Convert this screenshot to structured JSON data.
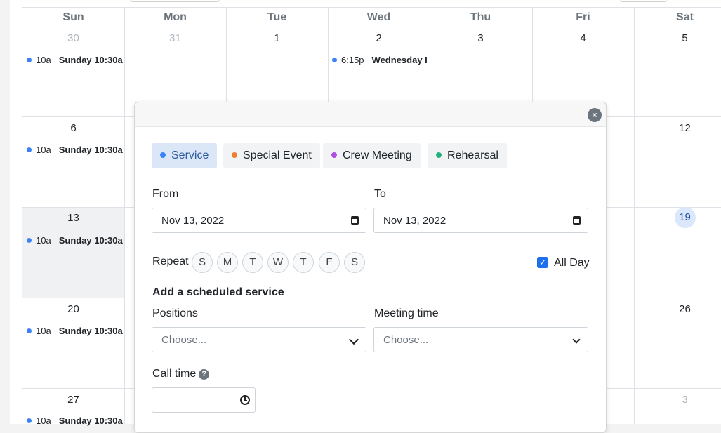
{
  "calendar": {
    "weekdays": [
      "Sun",
      "Mon",
      "Tue",
      "Wed",
      "Thu",
      "Fri",
      "Sat"
    ],
    "weeks": [
      [
        "30",
        "31",
        "1",
        "2",
        "3",
        "4",
        "5"
      ],
      [
        "6",
        "",
        "",
        "",
        "",
        "",
        "12"
      ],
      [
        "13",
        "",
        "",
        "",
        "",
        "",
        "19"
      ],
      [
        "20",
        "",
        "",
        "",
        "",
        "",
        "26"
      ],
      [
        "27",
        "",
        "",
        "",
        "",
        "",
        "3"
      ]
    ],
    "events": [
      {
        "time": "10a",
        "title": "Sunday 10:30a"
      },
      {
        "time": "6:15p",
        "title": "Wednesday I"
      },
      {
        "time": "10a",
        "title": "Sunday 10:30a"
      },
      {
        "time": "10a",
        "title": "Sunday 10:30a"
      },
      {
        "time": "10a",
        "title": "Sunday 10:30a"
      },
      {
        "time": "10a",
        "title": "Sunday 10:30a"
      }
    ],
    "event_color": "#3b82f6",
    "today_color": "#dbe7fb"
  },
  "modal": {
    "close_icon": "×",
    "categories": [
      {
        "label": "Service",
        "color": "#3b82f6"
      },
      {
        "label": "Special Event",
        "color": "#f07c2d"
      },
      {
        "label": "Crew Meeting",
        "color": "#b04ee0"
      },
      {
        "label": "Rehearsal",
        "color": "#22b07d"
      }
    ],
    "from_label": "From",
    "from_value": "Nov 13, 2022",
    "to_label": "To",
    "to_value": "Nov 13, 2022",
    "repeat_label": "Repeat",
    "repeat_days": [
      "S",
      "M",
      "T",
      "W",
      "T",
      "F",
      "S"
    ],
    "all_day_label": "All Day",
    "all_day_checked": true,
    "section_title": "Add a scheduled service",
    "positions_label": "Positions",
    "positions_placeholder": "Choose...",
    "meeting_time_label": "Meeting time",
    "meeting_time_placeholder": "Choose...",
    "call_time_label": "Call time",
    "help_icon": "?"
  }
}
